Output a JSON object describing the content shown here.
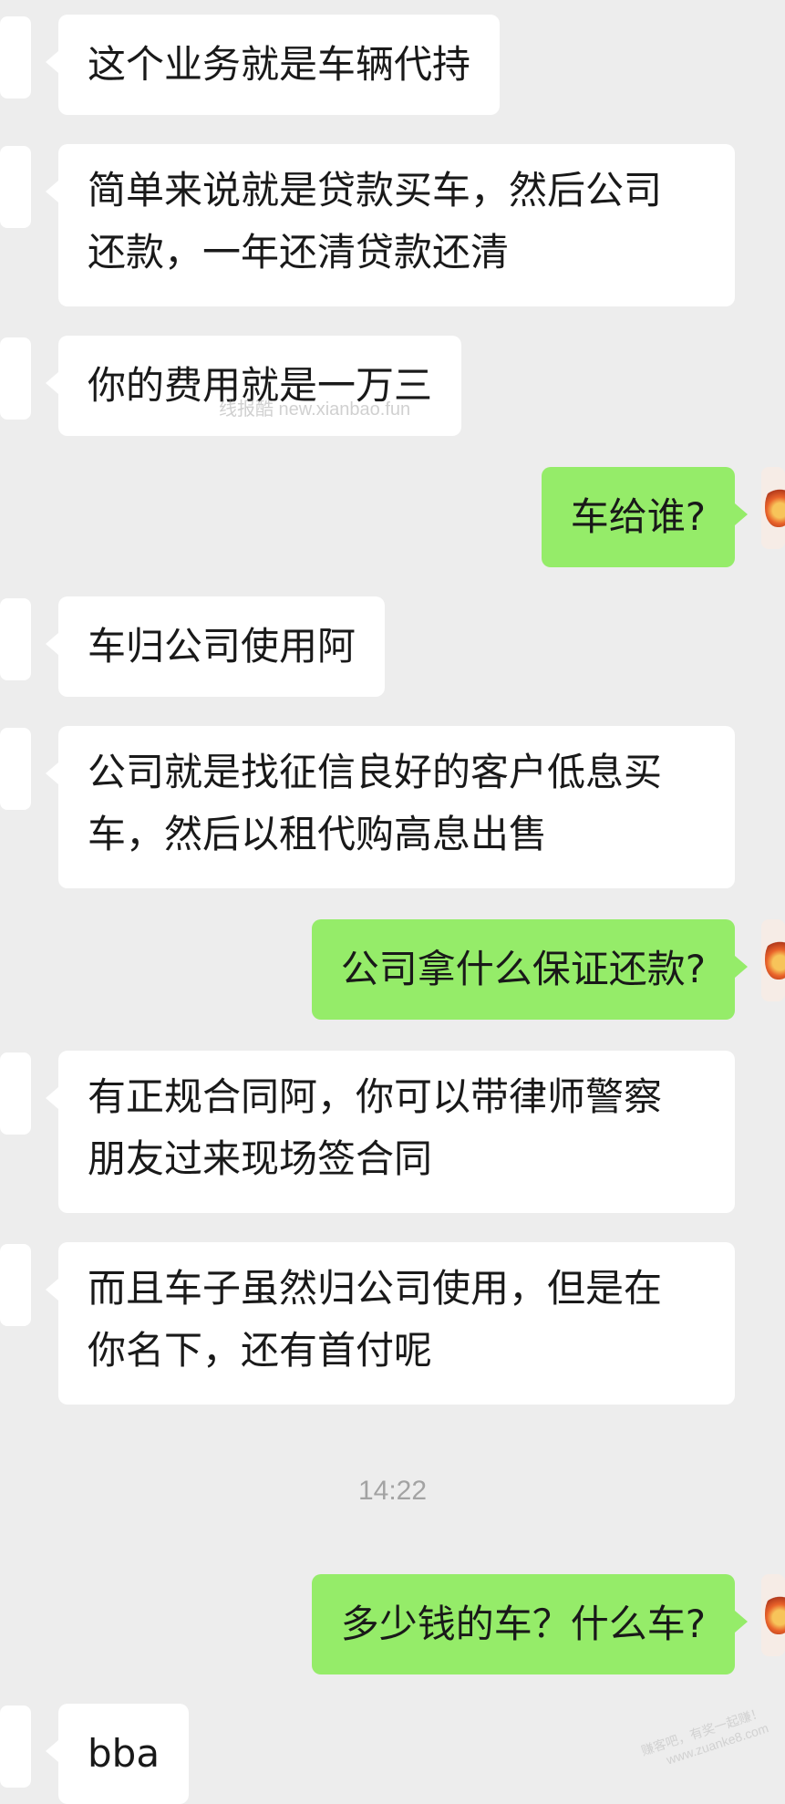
{
  "messages": [
    {
      "side": "in",
      "text": "这个业务就是车辆代持"
    },
    {
      "side": "in",
      "text": "简单来说就是贷款买车，然后公司\n还款，一年还清贷款还清"
    },
    {
      "side": "in",
      "text": "你的费用就是一万三"
    },
    {
      "side": "out",
      "text": "车给谁?"
    },
    {
      "side": "in",
      "text": "车归公司使用阿"
    },
    {
      "side": "in",
      "text": "公司就是找征信良好的客户低息买\n车，然后以租代购高息出售"
    },
    {
      "side": "out",
      "text": "公司拿什么保证还款?"
    },
    {
      "side": "in",
      "text": "有正规合同阿，你可以带律师警察\n朋友过来现场签合同"
    },
    {
      "side": "in",
      "text": "而且车子虽然归公司使用，但是在\n你名下，还有首付呢"
    },
    {
      "side": "out",
      "text": "多少钱的车？什么车?"
    },
    {
      "side": "in",
      "text": "bba"
    }
  ],
  "timestamp": "14:22",
  "watermark": "线报酷 new.xianbao.fun",
  "corner_mark": "赚客吧，有奖一起赚！\nwww.zuanke8.com",
  "colors": {
    "background": "#ededed",
    "incoming_bubble": "#ffffff",
    "outgoing_bubble": "#95ec69",
    "text": "#191919",
    "timestamp": "#a3a3a3"
  }
}
